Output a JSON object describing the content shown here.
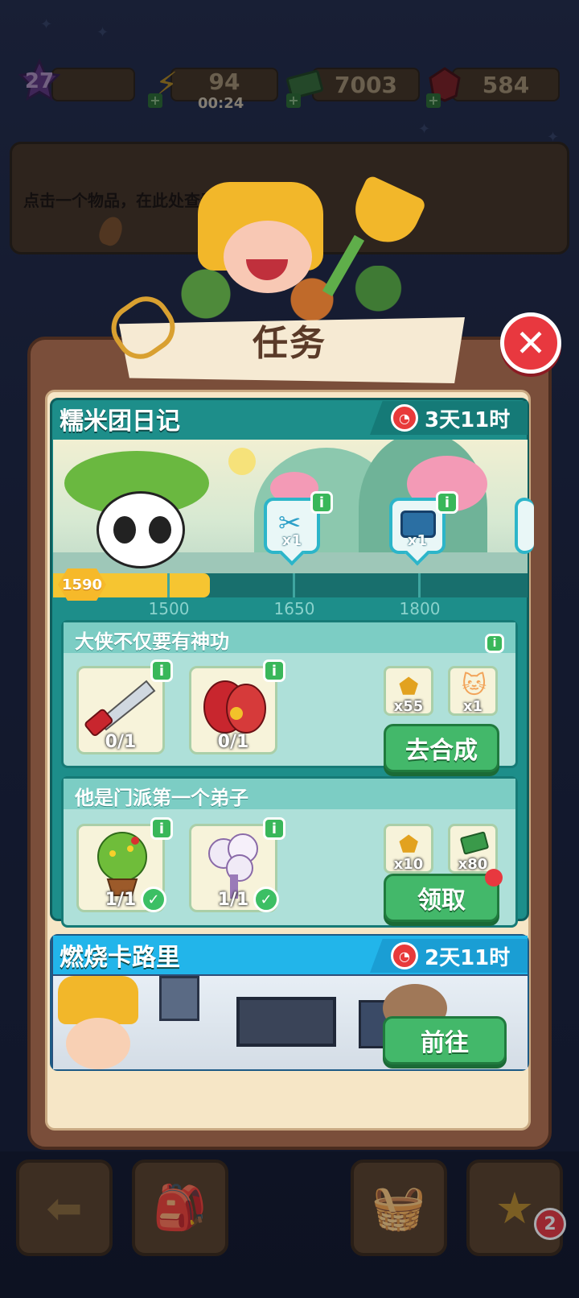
{
  "top_bar": {
    "level": "27",
    "energy": "94",
    "energy_timer": "00:24",
    "cash": "7003",
    "gems": "584"
  },
  "info_panel": {
    "hint_text": "点击一个物品，在此处查看"
  },
  "modal": {
    "title": "任务",
    "close_icon": "close-icon"
  },
  "quest1": {
    "title": "糯米团日记",
    "timer": "3天11时",
    "progress": {
      "value": "1590",
      "fill_fraction": 0.33,
      "ticks": [
        "1500",
        "1650",
        "1800"
      ]
    },
    "milestone_rewards": [
      {
        "icon": "scissors-icon",
        "count": "x1"
      },
      {
        "icon": "treasure-chest-icon",
        "count": "x1"
      }
    ],
    "tasks": [
      {
        "title": "大侠不仅要有神功",
        "items": [
          {
            "icon": "saw-icon",
            "progress": "0/1",
            "done": false
          },
          {
            "icon": "glove-icon",
            "progress": "0/1",
            "done": false
          }
        ],
        "rewards": [
          {
            "icon": "gold-ore-icon",
            "count": "x55"
          },
          {
            "icon": "cat-icon",
            "count": "x1"
          }
        ],
        "button": "去合成"
      },
      {
        "title": "他是门派第一个弟子",
        "items": [
          {
            "icon": "potted-tree-icon",
            "progress": "1/1",
            "done": true
          },
          {
            "icon": "flower-bouquet-icon",
            "progress": "1/1",
            "done": true
          }
        ],
        "rewards": [
          {
            "icon": "gold-ore-icon",
            "count": "x10"
          },
          {
            "icon": "cash-icon",
            "count": "x80"
          }
        ],
        "button": "领取"
      }
    ]
  },
  "quest2": {
    "title": "燃烧卡路里",
    "timer": "2天11时",
    "button": "前往"
  },
  "bottom_nav": {
    "badge_count": "2"
  }
}
